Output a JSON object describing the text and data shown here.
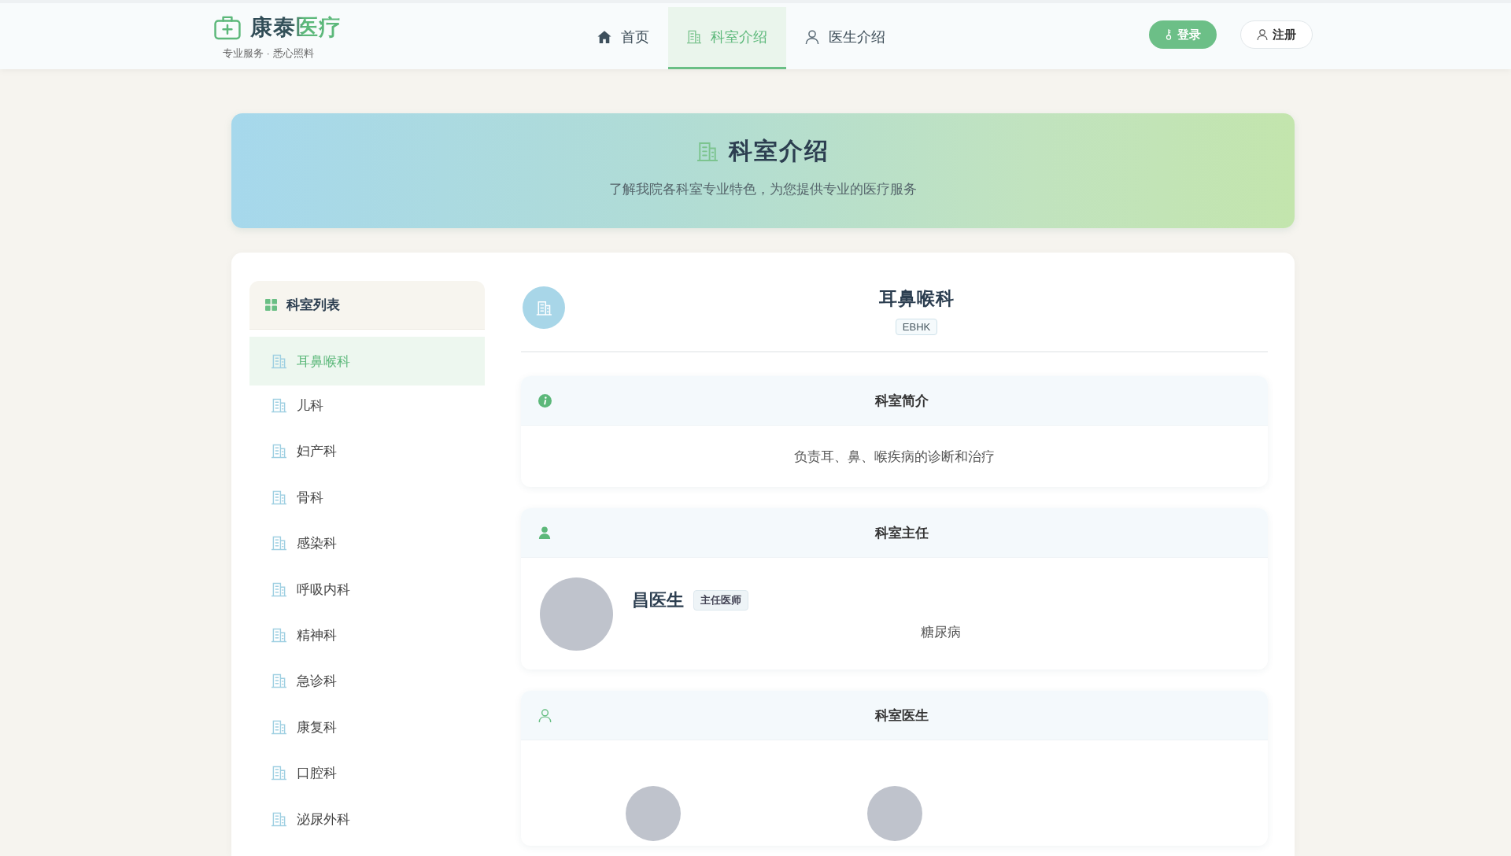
{
  "header": {
    "logo": {
      "title": "康泰医疗",
      "subtitle": "专业服务 · 悉心照料"
    },
    "nav": [
      {
        "label": "首页",
        "selected": false
      },
      {
        "label": "科室介绍",
        "selected": true
      },
      {
        "label": "医生介绍",
        "selected": false
      }
    ],
    "actions": [
      {
        "label": "登录",
        "kind": "primary"
      },
      {
        "label": "注册",
        "kind": "outline"
      }
    ]
  },
  "banner": {
    "title": "科室介绍",
    "subtitle": "了解我院各科室专业特色，为您提供专业的医疗服务"
  },
  "sidebar": {
    "title": "科室列表",
    "items": [
      {
        "label": "耳鼻喉科",
        "selected": true
      },
      {
        "label": "儿科",
        "selected": false
      },
      {
        "label": "妇产科",
        "selected": false
      },
      {
        "label": "骨科",
        "selected": false
      },
      {
        "label": "感染科",
        "selected": false
      },
      {
        "label": "呼吸内科",
        "selected": false
      },
      {
        "label": "精神科",
        "selected": false
      },
      {
        "label": "急诊科",
        "selected": false
      },
      {
        "label": "康复科",
        "selected": false
      },
      {
        "label": "口腔科",
        "selected": false
      },
      {
        "label": "泌尿外科",
        "selected": false
      }
    ]
  },
  "department": {
    "name": "耳鼻喉科",
    "code": "EBHK",
    "sections": [
      {
        "kind": "intro",
        "title": "科室简介",
        "text": "负责耳、鼻、喉疾病的诊断和治疗"
      },
      {
        "kind": "director",
        "title": "科室主任",
        "name": "昌医生",
        "rank": "主任医师",
        "specialty": "糖尿病"
      },
      {
        "kind": "doctors",
        "title": "科室医生",
        "doctors": [
          {
            "kind": "avatar"
          },
          {
            "kind": "avatar"
          }
        ]
      }
    ]
  }
}
